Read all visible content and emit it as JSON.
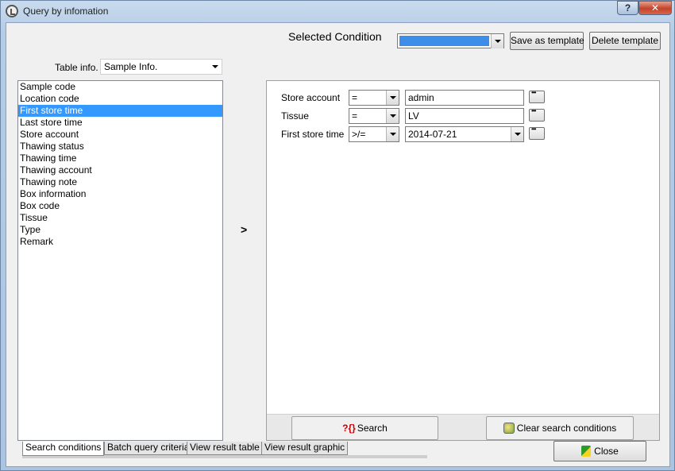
{
  "window": {
    "title": "Query by infomation",
    "help_label": "?",
    "close_label": "✕"
  },
  "header": {
    "selected_condition_label": "Selected Condition",
    "save_template_label": "Save as template",
    "delete_template_label": "Delete template",
    "template_selected_color": "#3d8ee8"
  },
  "table_info": {
    "label": "Table info.",
    "value": "Sample Info."
  },
  "fields": {
    "items": [
      {
        "label": "Sample code"
      },
      {
        "label": "Location code"
      },
      {
        "label": "First store time"
      },
      {
        "label": "Last store time"
      },
      {
        "label": "Store account"
      },
      {
        "label": "Thawing status"
      },
      {
        "label": "Thawing time"
      },
      {
        "label": "Thawing account"
      },
      {
        "label": "Thawing note"
      },
      {
        "label": "Box information"
      },
      {
        "label": "Box code"
      },
      {
        "label": "Tissue"
      },
      {
        "label": "Type"
      },
      {
        "label": "Remark"
      }
    ],
    "selected_index": 2
  },
  "move_arrow": ">",
  "conditions": [
    {
      "field": "Store account",
      "operator": "=",
      "value": "admin"
    },
    {
      "field": "Tissue",
      "operator": "=",
      "value": "LV"
    },
    {
      "field": "First store time",
      "operator": ">/=",
      "value": "2014-07-21"
    }
  ],
  "actions": {
    "search_label": "Search",
    "search_icon": "?{}",
    "clear_label": "Clear search conditions",
    "close_label": "Close"
  },
  "tabs": [
    {
      "label": "Search conditions",
      "active": true
    },
    {
      "label": "Batch query criteria",
      "active": false
    },
    {
      "label": "View result table",
      "active": false
    },
    {
      "label": "View result graphic",
      "active": false
    }
  ],
  "colors": {
    "selection": "#3399ff",
    "window_frame": "#b5cce6"
  }
}
